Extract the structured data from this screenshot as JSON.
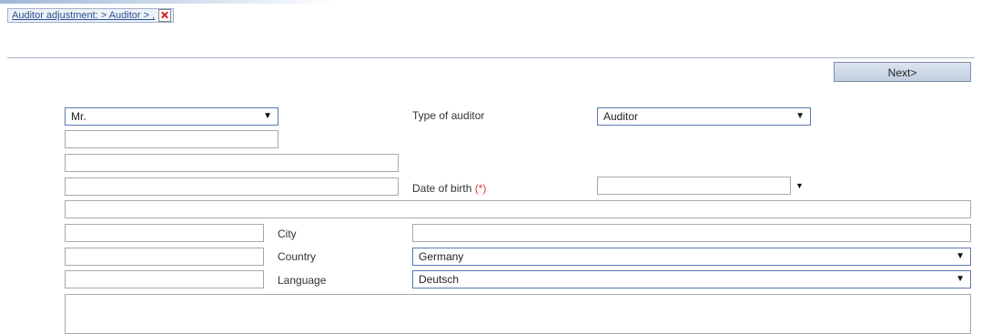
{
  "breadcrumb": {
    "label": "Auditor adjustment:  > Auditor > ,"
  },
  "toolbar": {
    "next_label": "Next>"
  },
  "form": {
    "salutation": {
      "value": "Mr."
    },
    "type_of_auditor": {
      "label": "Type of auditor",
      "value": "Auditor"
    },
    "date_of_birth": {
      "label": "Date of birth",
      "required_marker": "(*)"
    },
    "city": {
      "label": "City"
    },
    "country": {
      "label": "Country",
      "value": "Germany"
    },
    "language": {
      "label": "Language",
      "value": "Deutsch"
    }
  },
  "icons": {
    "close": "close-icon",
    "dropdown": "chevron-down-icon"
  },
  "colors": {
    "required": "#e0393b",
    "link": "#2a4f92"
  }
}
